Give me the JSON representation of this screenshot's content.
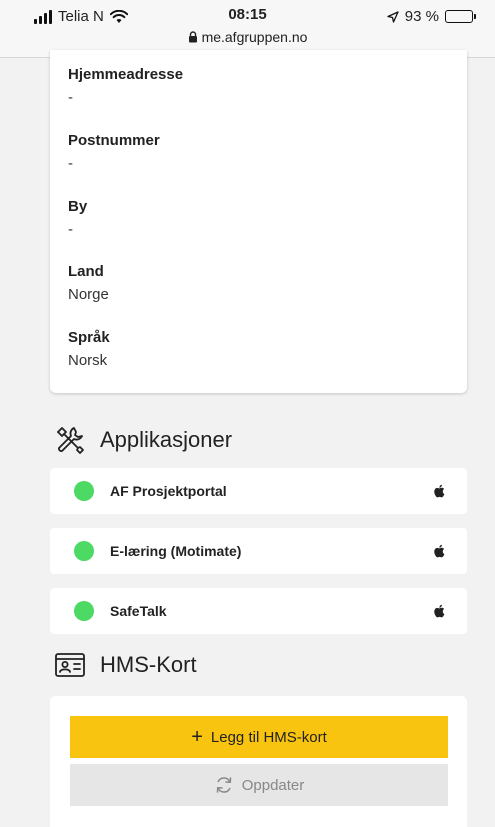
{
  "status_bar": {
    "carrier": "Telia N",
    "time": "08:15",
    "url": "me.afgruppen.no",
    "battery": "93 %",
    "battery_level": 0.93
  },
  "profile": {
    "fields": [
      {
        "label": "Hjemmeadresse",
        "value": "-"
      },
      {
        "label": "Postnummer",
        "value": "-"
      },
      {
        "label": "By",
        "value": "-"
      },
      {
        "label": "Land",
        "value": "Norge"
      },
      {
        "label": "Språk",
        "value": "Norsk"
      }
    ]
  },
  "applications": {
    "title": "Applikasjoner",
    "status_color": "#4cd964",
    "items": [
      {
        "name": "AF Prosjektportal",
        "icon": "apple-icon"
      },
      {
        "name": "E-læring (Motimate)",
        "icon": "apple-icon"
      },
      {
        "name": "SafeTalk",
        "icon": "apple-icon"
      }
    ]
  },
  "hms": {
    "title": "HMS-Kort",
    "add_label": "Legg til HMS-kort",
    "refresh_label": "Oppdater",
    "accent": "#f9c40f"
  }
}
